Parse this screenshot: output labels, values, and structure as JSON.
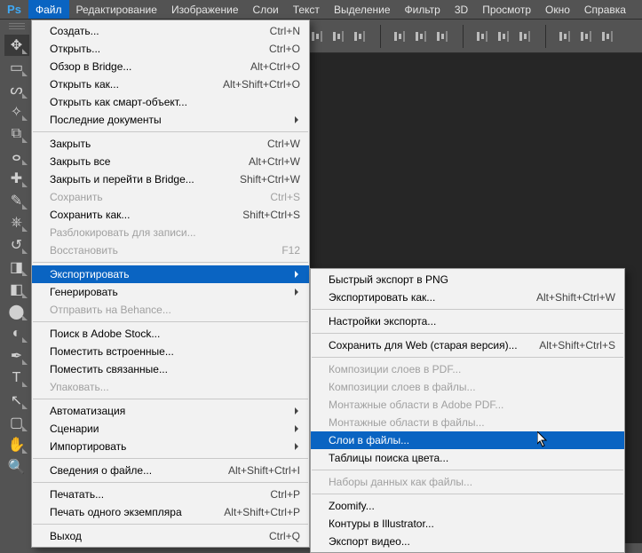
{
  "menubar": {
    "logo": "Ps",
    "items": [
      "Файл",
      "Редактирование",
      "Изображение",
      "Слои",
      "Текст",
      "Выделение",
      "Фильтр",
      "3D",
      "Просмотр",
      "Окно",
      "Справка"
    ],
    "activeIndex": 0
  },
  "optionBarGroups": [
    [
      "align-left-icon",
      "align-center-h-icon",
      "align-right-icon"
    ],
    [
      "align-top-icon",
      "align-center-v-icon",
      "align-bottom-icon"
    ],
    [
      "distribute-h-icon",
      "distribute-v-icon",
      "distribute-h2-icon"
    ],
    [
      "distribute-spacing-h-icon",
      "distribute-spacing-v-icon",
      "distribute-spacing-3-icon"
    ]
  ],
  "tools": [
    {
      "name": "move-tool",
      "glyph": "✥",
      "selected": true,
      "sub": true
    },
    {
      "name": "marquee-tool",
      "glyph": "▭",
      "sub": true
    },
    {
      "name": "lasso-tool",
      "glyph": "ᔕ",
      "sub": true
    },
    {
      "name": "magic-wand-tool",
      "glyph": "✧",
      "sub": true
    },
    {
      "name": "crop-tool",
      "glyph": "⧉",
      "sub": true
    },
    {
      "name": "eyedropper-tool",
      "glyph": "ⴰ",
      "sub": true
    },
    {
      "name": "healing-brush-tool",
      "glyph": "✚",
      "sub": true
    },
    {
      "name": "brush-tool",
      "glyph": "✎",
      "sub": true
    },
    {
      "name": "clone-stamp-tool",
      "glyph": "⎈",
      "sub": true
    },
    {
      "name": "history-brush-tool",
      "glyph": "↺",
      "sub": true
    },
    {
      "name": "eraser-tool",
      "glyph": "◨",
      "sub": true
    },
    {
      "name": "gradient-tool",
      "glyph": "◧",
      "sub": true
    },
    {
      "name": "blur-tool",
      "glyph": "⬤",
      "sub": true
    },
    {
      "name": "dodge-tool",
      "glyph": "◐",
      "sub": true
    },
    {
      "name": "pen-tool",
      "glyph": "✒",
      "sub": true
    },
    {
      "name": "type-tool",
      "glyph": "T",
      "sub": true
    },
    {
      "name": "path-selection-tool",
      "glyph": "↖",
      "sub": true
    },
    {
      "name": "rectangle-tool",
      "glyph": "▢",
      "sub": true
    },
    {
      "name": "hand-tool",
      "glyph": "✋",
      "sub": true
    },
    {
      "name": "zoom-tool",
      "glyph": "🔍",
      "sub": false
    }
  ],
  "fileMenu": [
    {
      "label": "Создать...",
      "shortcut": "Ctrl+N"
    },
    {
      "label": "Открыть...",
      "shortcut": "Ctrl+O"
    },
    {
      "label": "Обзор в Bridge...",
      "shortcut": "Alt+Ctrl+O"
    },
    {
      "label": "Открыть как...",
      "shortcut": "Alt+Shift+Ctrl+O"
    },
    {
      "label": "Открыть как смарт-объект..."
    },
    {
      "label": "Последние документы",
      "sub": true
    },
    {
      "sep": true
    },
    {
      "label": "Закрыть",
      "shortcut": "Ctrl+W"
    },
    {
      "label": "Закрыть все",
      "shortcut": "Alt+Ctrl+W"
    },
    {
      "label": "Закрыть и перейти в Bridge...",
      "shortcut": "Shift+Ctrl+W"
    },
    {
      "label": "Сохранить",
      "shortcut": "Ctrl+S",
      "disabled": true
    },
    {
      "label": "Сохранить как...",
      "shortcut": "Shift+Ctrl+S"
    },
    {
      "label": "Разблокировать для записи...",
      "disabled": true
    },
    {
      "label": "Восстановить",
      "shortcut": "F12",
      "disabled": true
    },
    {
      "sep": true
    },
    {
      "label": "Экспортировать",
      "sub": true,
      "highlight": true
    },
    {
      "label": "Генерировать",
      "sub": true
    },
    {
      "label": "Отправить на Behance...",
      "disabled": true
    },
    {
      "sep": true
    },
    {
      "label": "Поиск в Adobe Stock..."
    },
    {
      "label": "Поместить встроенные..."
    },
    {
      "label": "Поместить связанные..."
    },
    {
      "label": "Упаковать...",
      "disabled": true
    },
    {
      "sep": true
    },
    {
      "label": "Автоматизация",
      "sub": true
    },
    {
      "label": "Сценарии",
      "sub": true
    },
    {
      "label": "Импортировать",
      "sub": true
    },
    {
      "sep": true
    },
    {
      "label": "Сведения о файле...",
      "shortcut": "Alt+Shift+Ctrl+I"
    },
    {
      "sep": true
    },
    {
      "label": "Печатать...",
      "shortcut": "Ctrl+P"
    },
    {
      "label": "Печать одного экземпляра",
      "shortcut": "Alt+Shift+Ctrl+P"
    },
    {
      "sep": true
    },
    {
      "label": "Выход",
      "shortcut": "Ctrl+Q"
    }
  ],
  "exportSubmenu": [
    {
      "label": "Быстрый экспорт в PNG"
    },
    {
      "label": "Экспортировать как...",
      "shortcut": "Alt+Shift+Ctrl+W"
    },
    {
      "sep": true
    },
    {
      "label": "Настройки экспорта..."
    },
    {
      "sep": true
    },
    {
      "label": "Сохранить для Web (старая версия)...",
      "shortcut": "Alt+Shift+Ctrl+S"
    },
    {
      "sep": true
    },
    {
      "label": "Композиции слоев в PDF...",
      "disabled": true
    },
    {
      "label": "Композиции слоев в файлы...",
      "disabled": true
    },
    {
      "label": "Монтажные области в Adobe PDF...",
      "disabled": true
    },
    {
      "label": "Монтажные области в файлы...",
      "disabled": true
    },
    {
      "label": "Слои в файлы...",
      "highlight": true
    },
    {
      "label": "Таблицы поиска цвета..."
    },
    {
      "sep": true
    },
    {
      "label": "Наборы данных как файлы...",
      "disabled": true
    },
    {
      "sep": true
    },
    {
      "label": "Zoomify..."
    },
    {
      "label": "Контуры в Illustrator..."
    },
    {
      "label": "Экспорт видео..."
    }
  ]
}
